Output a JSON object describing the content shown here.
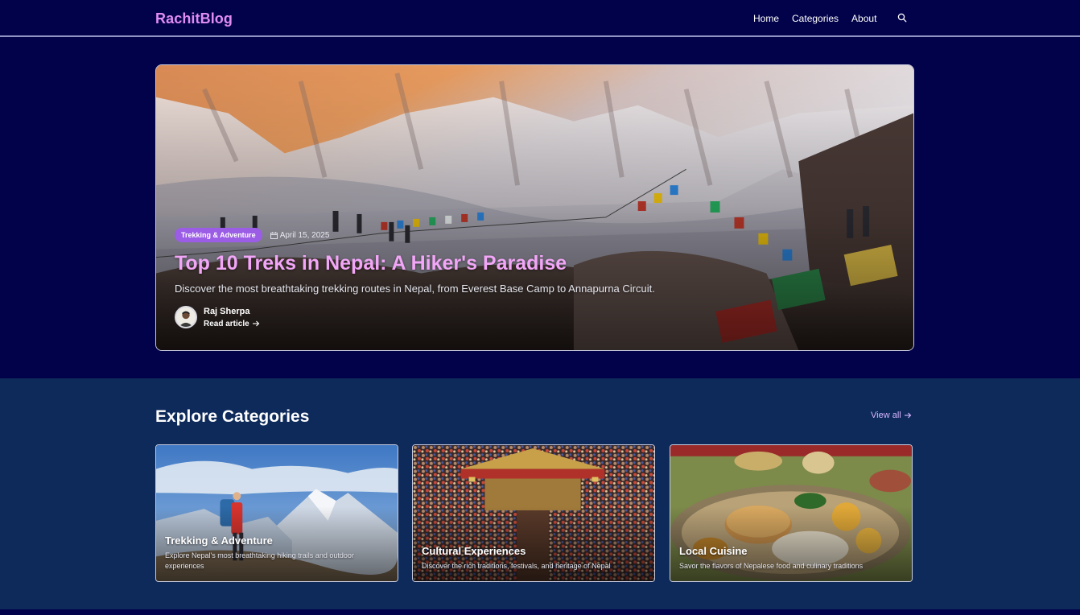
{
  "nav": {
    "brand": "RachitBlog",
    "links": [
      "Home",
      "Categories",
      "About"
    ],
    "search_icon": "search-icon"
  },
  "hero": {
    "category": "Trekking & Adventure",
    "date": "April 15, 2025",
    "title": "Top 10 Treks in Nepal: A Hiker's Paradise",
    "description": "Discover the most breathtaking trekking routes in Nepal, from Everest Base Camp to Annapurna Circuit.",
    "author": "Raj Sherpa",
    "read_label": "Read article",
    "calendar_icon": "calendar-icon",
    "arrow_icon": "arrow-right-icon"
  },
  "categories": {
    "heading": "Explore Categories",
    "view_all": "View all",
    "items": [
      {
        "name": "Trekking & Adventure",
        "description": "Explore Nepal's most breathtaking hiking trails and outdoor experiences"
      },
      {
        "name": "Cultural Experiences",
        "description": "Discover the rich traditions, festivals, and heritage of Nepal"
      },
      {
        "name": "Local Cuisine",
        "description": "Savor the flavors of Nepalese food and culinary traditions"
      }
    ]
  },
  "colors": {
    "page_bg": "#02024a",
    "section_bg": "#0d2a5a",
    "brand": "#e08cf3",
    "hero_title": "#f2a6f7",
    "badge": "#9b5ce6",
    "link": "#d8b6ff"
  }
}
